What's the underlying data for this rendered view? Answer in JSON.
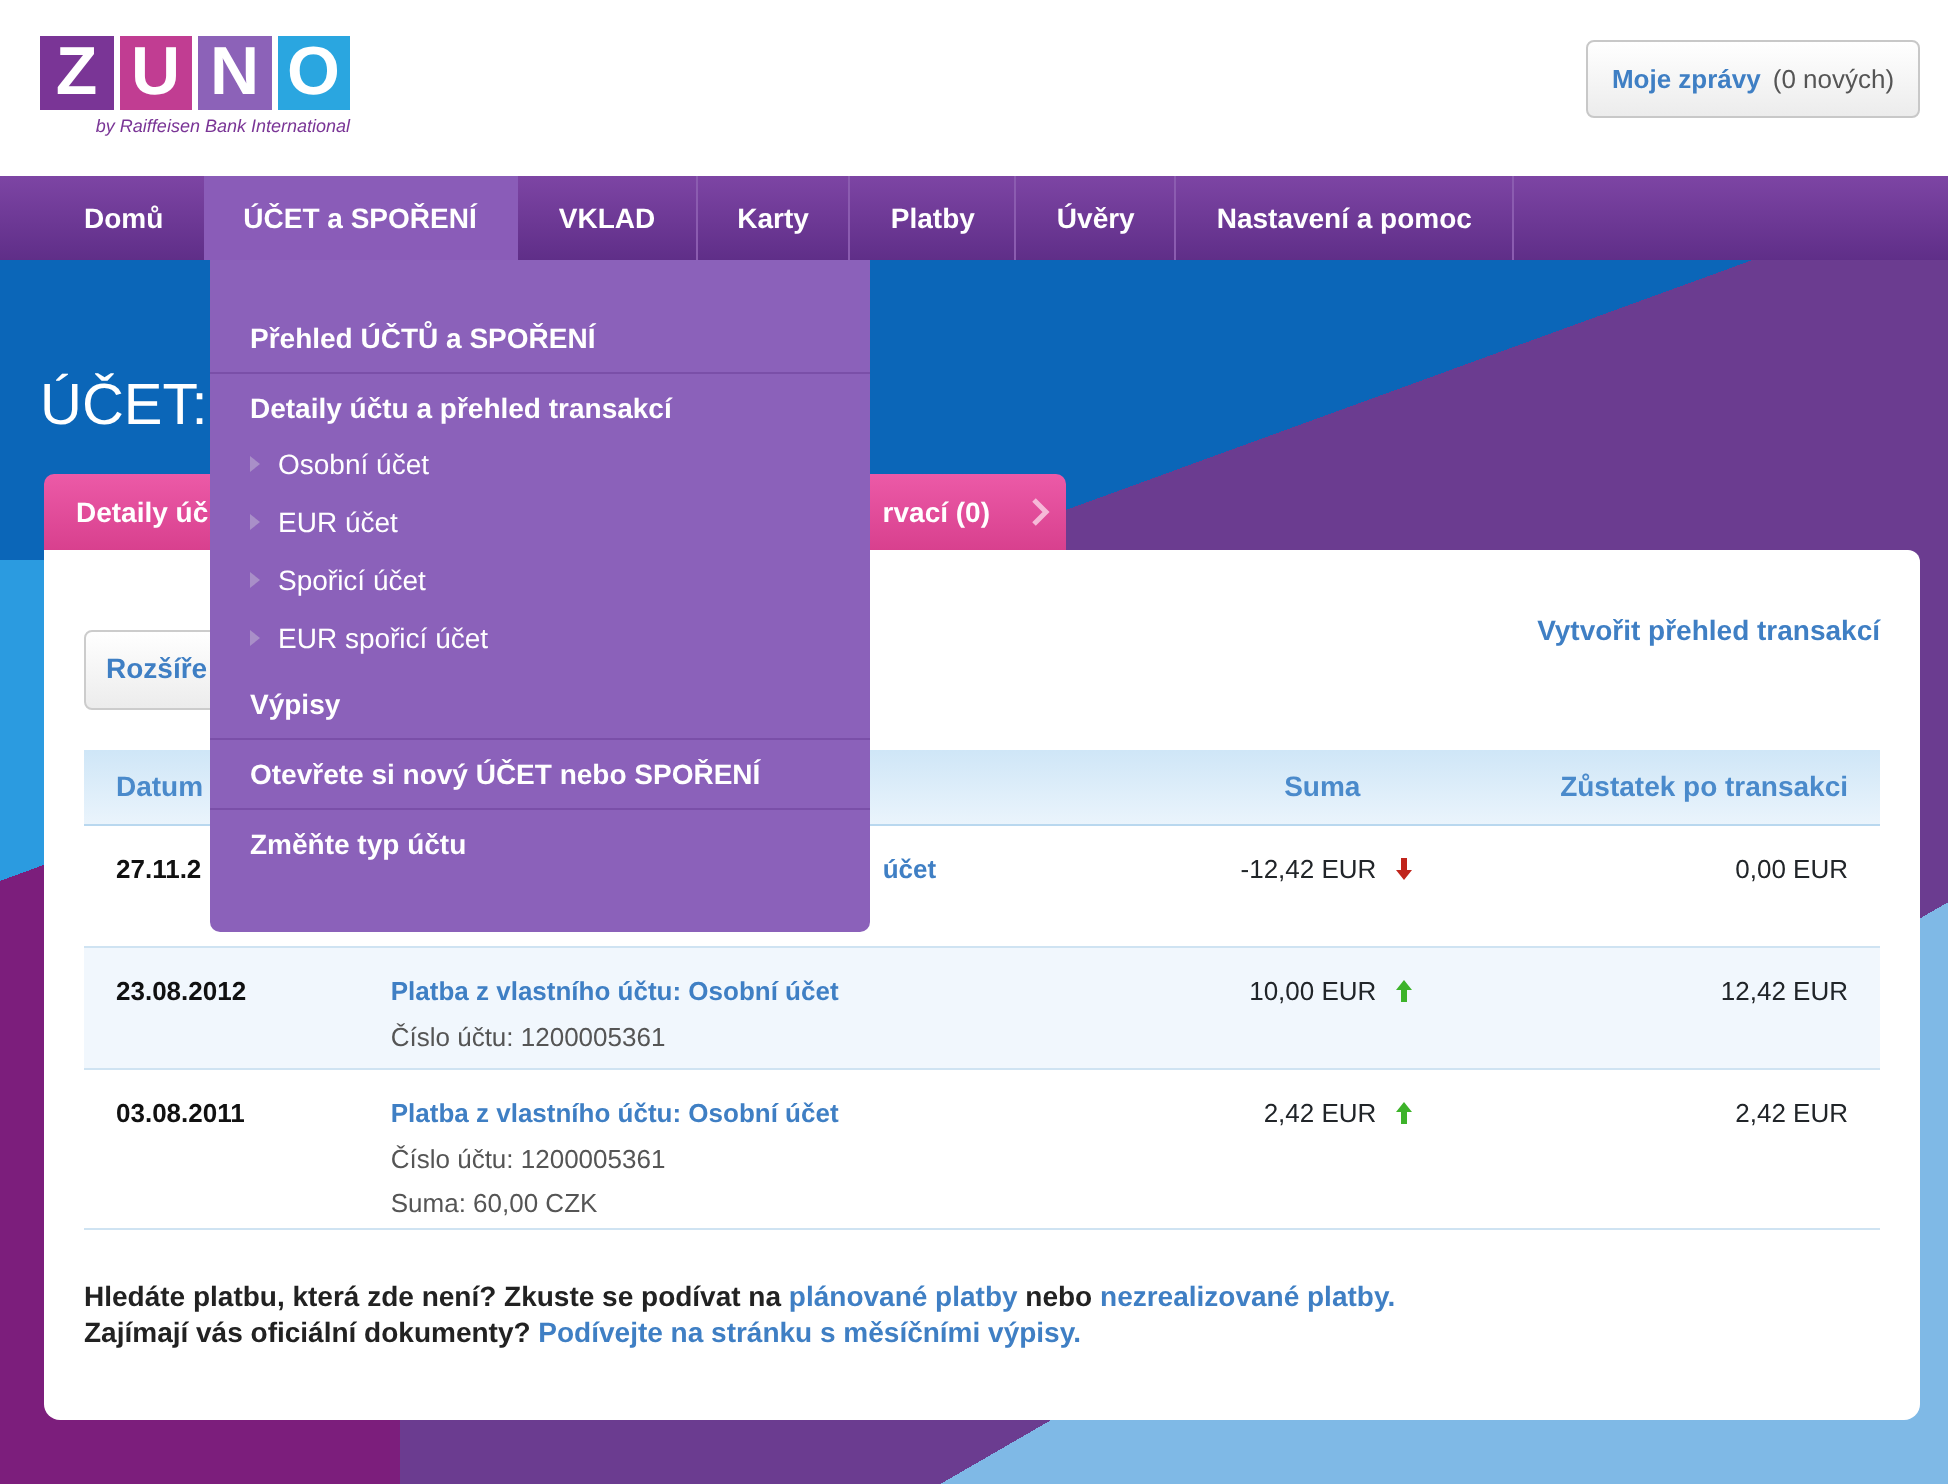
{
  "header": {
    "logo": {
      "letters": [
        {
          "char": "Z",
          "color": "#7a3596"
        },
        {
          "char": "U",
          "color": "#c13d92"
        },
        {
          "char": "N",
          "color": "#8c62b8"
        },
        {
          "char": "O",
          "color": "#2aa6e0"
        }
      ],
      "tagline": "by Raiffeisen Bank International"
    },
    "messages": {
      "label": "Moje zprávy",
      "count": "(0 nových)"
    }
  },
  "nav": [
    {
      "label": "Domů",
      "selected": false
    },
    {
      "label": "ÚČET a SPOŘENÍ",
      "selected": true
    },
    {
      "label": "VKLAD",
      "selected": false
    },
    {
      "label": "Karty",
      "selected": false
    },
    {
      "label": "Platby",
      "selected": false
    },
    {
      "label": "Úvěry",
      "selected": false
    },
    {
      "label": "Nastavení a pomoc",
      "selected": false
    }
  ],
  "dropdown": {
    "items": [
      {
        "label": "Přehled ÚČTŮ a SPOŘENÍ"
      },
      {
        "label": "Detaily účtu a přehled transakcí",
        "children": [
          {
            "label": "Osobní účet"
          },
          {
            "label": "EUR účet"
          },
          {
            "label": "Spořicí účet"
          },
          {
            "label": "EUR spořicí účet"
          }
        ]
      },
      {
        "label": "Výpisy"
      },
      {
        "label": "Otevřete si nový ÚČET nebo SPOŘENÍ"
      },
      {
        "label": "Změňte typ účtu"
      }
    ]
  },
  "page_title": "ÚČET:",
  "tabs": [
    {
      "label": "Detaily úč",
      "selected": false,
      "kind": "left"
    },
    {
      "label": "rvací (0)",
      "selected": false,
      "kind": "right"
    }
  ],
  "create_link": "Vytvořit přehled transakcí",
  "search_button": "Rozšíře",
  "table": {
    "columns": [
      "Datum",
      "Suma",
      "Zůstatek po transakci"
    ],
    "rows": [
      {
        "kind": "covered",
        "date": "27.11.2",
        "title": "účet",
        "lines": [],
        "amount": "-12,42 EUR",
        "increase": false,
        "balance": "0,00 EUR"
      },
      {
        "kind": "full",
        "date": "23.08.2012",
        "title": "Platba z vlastního účtu: Osobní účet",
        "lines": [
          "Číslo účtu: 1200005361"
        ],
        "amount": "10,00 EUR",
        "increase": true,
        "balance": "12,42 EUR"
      },
      {
        "kind": "full",
        "date": "03.08.2011",
        "title": "Platba z vlastního účtu: Osobní účet",
        "lines": [
          "Číslo účtu: 1200005361",
          "Suma: 60,00 CZK"
        ],
        "amount": "2,42 EUR",
        "increase": true,
        "balance": "2,42 EUR"
      }
    ]
  },
  "notes": [
    {
      "parts": [
        {
          "link": false,
          "text": "Hledáte platbu, která zde není? Zkuste se podívat na "
        },
        {
          "link": true,
          "text": "plánované platby"
        },
        {
          "link": false,
          "text": " nebo "
        },
        {
          "link": true,
          "text": "nezrealizované platby."
        }
      ]
    },
    {
      "parts": [
        {
          "link": false,
          "text": "Zajímají vás oficiální dokumenty? "
        },
        {
          "link": true,
          "text": "Podívejte na stránku s měsíčními výpisy."
        }
      ]
    }
  ]
}
